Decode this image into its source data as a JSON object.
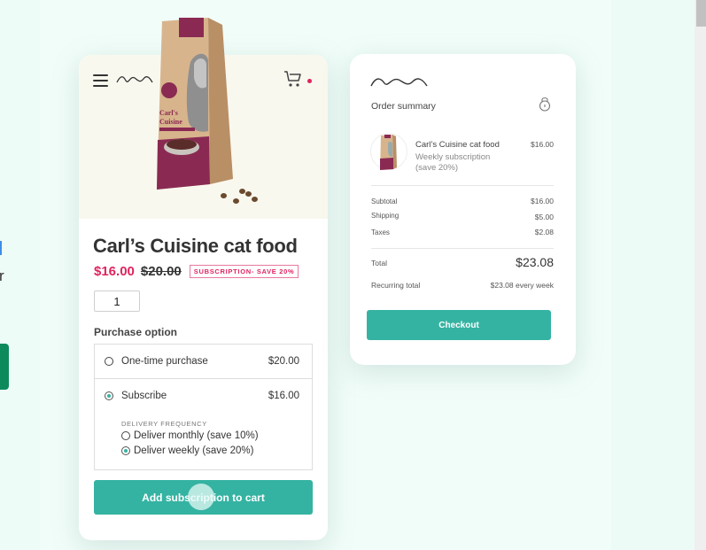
{
  "colors": {
    "accent": "#35b3a2",
    "sale": "#e0245e",
    "background": "#eefcf8"
  },
  "background_page": {
    "partial_text": "r"
  },
  "product": {
    "menu_icon": "hamburger-menu-icon",
    "logo_icon": "wave-logo-icon",
    "cart_icon": "shopping-cart-icon",
    "cart_has_notification": true,
    "image_alt": "Carl's Cuisine cat food bag",
    "bag_brand_line1": "Carl's",
    "bag_brand_line2": "Cuisine",
    "title": "Carl’s Cuisine cat food",
    "price_now": "$16.00",
    "price_was": "$20.00",
    "badge": "SUBSCRIPTION- SAVE 20%",
    "quantity": "1",
    "purchase_option_label": "Purchase option",
    "options": [
      {
        "label": "One-time purchase",
        "price": "$20.00",
        "selected": false
      },
      {
        "label": "Subscribe",
        "price": "$16.00",
        "selected": true
      }
    ],
    "delivery_frequency_label": "DELIVERY FREQUENCY",
    "frequencies": [
      {
        "label": "Deliver monthly (save 10%)",
        "selected": false
      },
      {
        "label": "Deliver weekly (save 20%)",
        "selected": true
      }
    ],
    "add_button": "Add subscription to cart"
  },
  "summary": {
    "logo_icon": "wave-logo-icon",
    "title": "Order summary",
    "lock_icon": "lock-icon",
    "item": {
      "name": "Carl’s Cuisine cat food",
      "detail1": "Weekly subscription",
      "detail2": "(save 20%)",
      "price": "$16.00"
    },
    "lines": [
      {
        "label": "Subtotal",
        "value": "$16.00"
      },
      {
        "label": "Shipping",
        "value": "$5.00"
      },
      {
        "label": "Taxes",
        "value": "$2.08"
      }
    ],
    "total_label": "Total",
    "total_value": "$23.08",
    "recurring_label": "Recurring total",
    "recurring_value": "$23.08 every week",
    "checkout": "Checkout"
  }
}
